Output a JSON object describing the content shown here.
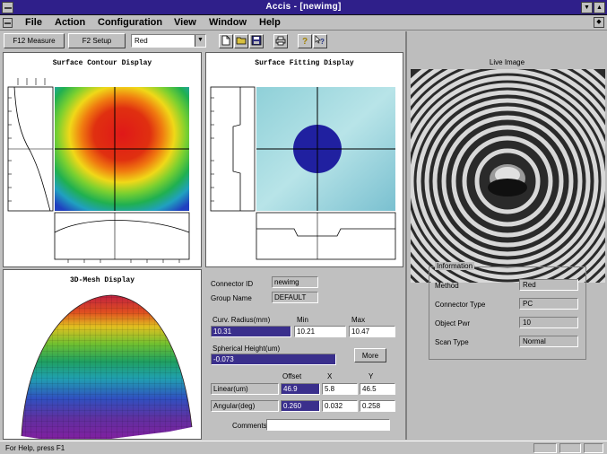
{
  "window": {
    "title": "Accis - [newimg]"
  },
  "menu": {
    "items": [
      "File",
      "Action",
      "Configuration",
      "View",
      "Window",
      "Help"
    ]
  },
  "toolbar": {
    "measure_label": "F12 Measure",
    "setup_label": "F2 Setup",
    "color_value": "Red"
  },
  "panels": {
    "contour_title": "Surface Contour Display",
    "fitting_title": "Surface Fitting Display",
    "mesh_title": "3D-Mesh Display"
  },
  "data": {
    "connector_id_label": "Connector ID",
    "connector_id_value": "newimg",
    "group_name_label": "Group Name",
    "group_name_value": "DEFAULT",
    "curv_label": "Curv. Radius(mm)",
    "min_label": "Min",
    "max_label": "Max",
    "curv_value": "10.31",
    "curv_min": "10.21",
    "curv_max": "10.47",
    "spherical_label": "Spherical Height(um)",
    "spherical_value": "-0.073",
    "more_label": "More",
    "offset_label": "Offset",
    "x_label": "X",
    "y_label": "Y",
    "linear_label": "Linear(um)",
    "linear_offset": "46.9",
    "linear_x": "5.8",
    "linear_y": "46.5",
    "angular_label": "Angular(deg)",
    "angular_offset": "0.260",
    "angular_x": "0.032",
    "angular_y": "0.258",
    "comments_label": "Comments"
  },
  "live": {
    "label": "Live Image",
    "info_title": "Information",
    "rows": [
      {
        "label": "Method",
        "value": "Red"
      },
      {
        "label": "Connector Type",
        "value": "PC"
      },
      {
        "label": "Object Pwr",
        "value": "10"
      },
      {
        "label": "Scan Type",
        "value": "Normal"
      }
    ]
  },
  "status": {
    "text": "For Help, press F1"
  }
}
